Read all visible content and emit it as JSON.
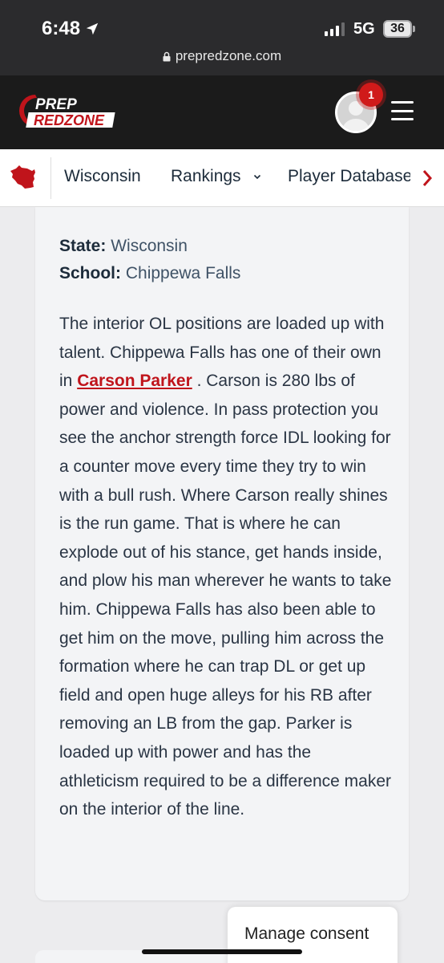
{
  "status": {
    "time": "6:48",
    "network": "5G",
    "battery": "36"
  },
  "browser": {
    "url": "prepredzone.com"
  },
  "header": {
    "logo_line1": "PREP",
    "logo_line2": "REDZONE",
    "notification_count": "1"
  },
  "nav": {
    "items": [
      {
        "label": "Wisconsin"
      },
      {
        "label": "Rankings"
      },
      {
        "label": "Player Database"
      }
    ]
  },
  "article": {
    "state_label": "State:",
    "state_value": "Wisconsin",
    "school_label": "School:",
    "school_value": "Chippewa Falls",
    "body_before": "The interior OL positions are loaded up with talent. Chippewa Falls has one of their own in ",
    "player_link": "Carson Parker",
    "body_after": " . Carson is 280 lbs of power and violence. In pass protection you see the anchor strength force IDL looking for a counter move every time they try to win with a bull rush. Where Carson really shines is the run game. That is where he can explode out of his stance, get hands inside, and plow his man wherever he wants to take him. Chippewa Falls has also been able to get him on the move, pulling him across the formation where he can trap DL or get up field and open huge alleys for his RB after removing an LB from the gap. Parker is loaded up with power and has the athleticism required to be a difference maker on the interior of the line."
  },
  "consent": {
    "label": "Manage consent"
  },
  "colors": {
    "brand_red": "#c0141b",
    "header_bg": "#1b1b1b",
    "badge_red": "#d01a1a"
  }
}
